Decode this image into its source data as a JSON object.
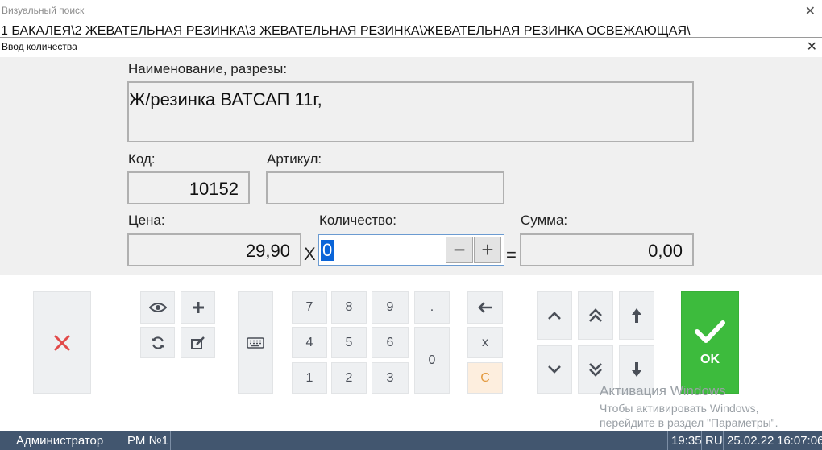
{
  "background": {
    "title": "Визуальный поиск",
    "path": "1 БАКАЛЕЯ\\2 ЖЕВАТЕЛЬНАЯ РЕЗИНКА\\3 ЖЕВАТЕЛЬНАЯ РЕЗИНКА\\ЖЕВАТЕЛЬНАЯ РЕЗИНКА ОСВЕЖАЮЩАЯ\\"
  },
  "dialog": {
    "title": "Ввод количества",
    "name_label": "Наименование, разрезы:",
    "name_value": "Ж/резинка ВАТСАП 11г,",
    "code_label": "Код:",
    "code_value": "10152",
    "article_label": "Артикул:",
    "article_value": "",
    "price_label": "Цена:",
    "price_value": "29,90",
    "multiply_sign": "X",
    "quantity_label": "Количество:",
    "quantity_value": "0",
    "minus_label": "−",
    "plus_label": "+",
    "equals_sign": "=",
    "sum_label": "Сумма:",
    "sum_value": "0,00"
  },
  "keypad": {
    "digits": [
      "7",
      "8",
      "9",
      "4",
      "5",
      "6",
      "1",
      "2",
      "3",
      "0"
    ],
    "dot": ".",
    "multiply": "x",
    "clear": "C",
    "ok": "OK"
  },
  "watermark": {
    "title": "Активация Windows",
    "line1": "Чтобы активировать Windows,",
    "line2": "перейдите в раздел \"Параметры\"."
  },
  "status": {
    "user": "Администратор",
    "workstation": "РМ №1",
    "time_short": "19:35",
    "lang": "RU",
    "date": "25.02.22",
    "clock": "16:07:06"
  },
  "colors": {
    "ok_green": "#3dbb3d",
    "cancel_red": "#e24a4a",
    "taskbar": "#42566f",
    "selection": "#0a64d8"
  }
}
